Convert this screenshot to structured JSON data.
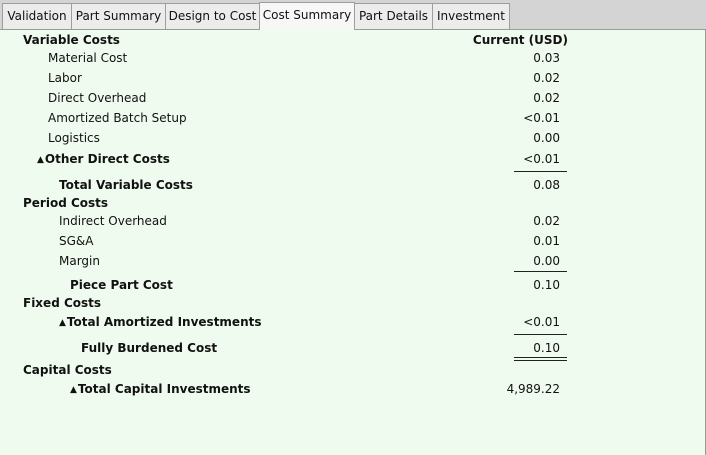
{
  "tabs": [
    {
      "label": "Validation"
    },
    {
      "label": "Part Summary"
    },
    {
      "label": "Design to Cost"
    },
    {
      "label": "Cost Summary",
      "active": true
    },
    {
      "label": "Part Details"
    },
    {
      "label": "Investment"
    }
  ],
  "header": {
    "current": "Current (USD)"
  },
  "variable_costs": {
    "title": "Variable Costs",
    "material": {
      "label": "Material Cost",
      "value": "0.03"
    },
    "labor": {
      "label": "Labor",
      "value": "0.02"
    },
    "direct_overhead": {
      "label": "Direct Overhead",
      "value": "0.02"
    },
    "amortized_batch": {
      "label": "Amortized Batch Setup",
      "value": "<0.01"
    },
    "logistics": {
      "label": "Logistics",
      "value": "0.00"
    },
    "other_direct": {
      "label": "Other Direct Costs",
      "value": "<0.01"
    },
    "total": {
      "label": "Total Variable Costs",
      "value": "0.08"
    }
  },
  "period_costs": {
    "title": "Period Costs",
    "indirect_overhead": {
      "label": "Indirect Overhead",
      "value": "0.02"
    },
    "sga": {
      "label": "SG&A",
      "value": "0.01"
    },
    "margin": {
      "label": "Margin",
      "value": "0.00"
    },
    "piece_part": {
      "label": "Piece Part Cost",
      "value": "0.10"
    }
  },
  "fixed_costs": {
    "title": "Fixed Costs",
    "amortized_investments": {
      "label": "Total Amortized Investments",
      "value": "<0.01"
    },
    "fully_burdened": {
      "label": "Fully Burdened Cost",
      "value": "0.10"
    }
  },
  "capital_costs": {
    "title": "Capital Costs",
    "capital_investments": {
      "label": "Total Capital Investments",
      "value": "4,989.22"
    }
  }
}
